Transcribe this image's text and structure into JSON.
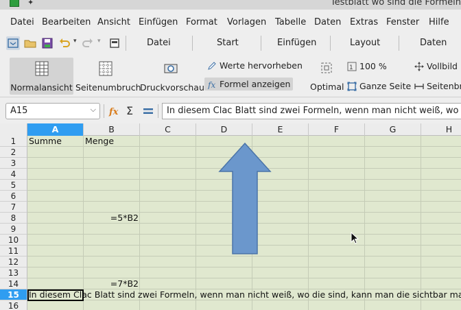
{
  "window": {
    "title": "Testblatt wo sind die Formeln"
  },
  "menu": [
    "Datei",
    "Bearbeiten",
    "Ansicht",
    "Einfügen",
    "Format",
    "Vorlagen",
    "Tabelle",
    "Daten",
    "Extras",
    "Fenster",
    "Hilfe"
  ],
  "tabs": [
    "Datei",
    "Start",
    "Einfügen",
    "Layout",
    "Daten"
  ],
  "ribbon": {
    "normal_view": "Normalansicht",
    "page_break": "Seitenumbruch",
    "print_preview": "Druckvorschau",
    "highlight_values": "Werte hervorheben",
    "show_formula": "Formel anzeigen",
    "zoom_value": "100 %",
    "optimal": "Optimal",
    "whole_page": "Ganze Seite",
    "full_screen": "Vollbild",
    "page_width": "Seitenbreite"
  },
  "formula_bar": {
    "cell_ref": "A15",
    "content": "In diesem Clac Blatt sind zwei Formeln, wenn man nicht weiß, wo die sind, kann man die sichtbar machen?"
  },
  "sheet": {
    "columns": [
      "A",
      "B",
      "C",
      "D",
      "E",
      "F",
      "G",
      "H"
    ],
    "rows": [
      "1",
      "2",
      "3",
      "4",
      "5",
      "6",
      "7",
      "8",
      "9",
      "10",
      "11",
      "12",
      "13",
      "14",
      "15",
      "16"
    ],
    "selected_column": "A",
    "selected_row": "15",
    "cells": {
      "A1": "Summe",
      "B1": "Menge",
      "B8": "=5*B2",
      "B14": "=7*B2",
      "A15": "In diesem Clac Blatt sind zwei Formeln, wenn man nicht weiß, wo die sind, kann man die sichtbar machen?"
    }
  },
  "colors": {
    "sheet_background": "#e0e8cf",
    "selection": "#2f9df1",
    "arrow_fill": "#6b97cc"
  }
}
